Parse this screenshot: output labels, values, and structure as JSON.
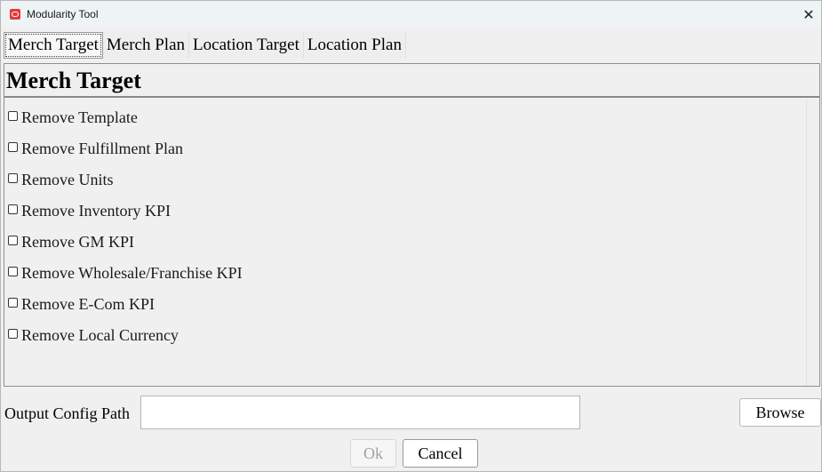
{
  "window": {
    "title": "Modularity Tool",
    "close_label": "✕"
  },
  "tabs": [
    {
      "label": "Merch Target",
      "active": true
    },
    {
      "label": "Merch Plan",
      "active": false
    },
    {
      "label": "Location Target",
      "active": false
    },
    {
      "label": "Location Plan",
      "active": false
    }
  ],
  "panel": {
    "title": "Merch Target",
    "options": [
      {
        "label": "Remove Template",
        "checked": false
      },
      {
        "label": "Remove Fulfillment Plan",
        "checked": false
      },
      {
        "label": "Remove Units",
        "checked": false
      },
      {
        "label": "Remove Inventory KPI",
        "checked": false
      },
      {
        "label": "Remove GM KPI",
        "checked": false
      },
      {
        "label": "Remove Wholesale/Franchise KPI",
        "checked": false
      },
      {
        "label": "Remove E-Com KPI",
        "checked": false
      },
      {
        "label": "Remove Local Currency",
        "checked": false
      }
    ]
  },
  "footer": {
    "path_label": "Output Config Path",
    "path_value": "",
    "browse_label": "Browse",
    "ok_label": "Ok",
    "cancel_label": "Cancel"
  },
  "colors": {
    "background": "#f0f0f0",
    "titlebar": "#eef3f6",
    "app_icon": "#e23b3b",
    "disabled_text": "#a0a0a0"
  }
}
